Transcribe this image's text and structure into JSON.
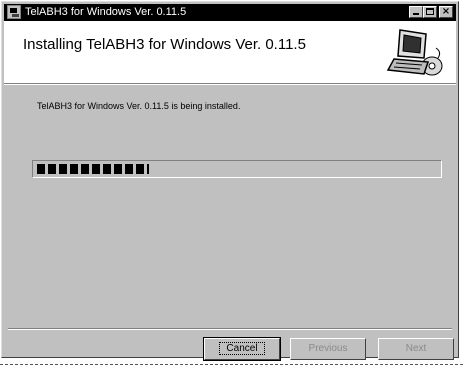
{
  "window": {
    "title": "TelABH3 for Windows Ver. 0.11.5"
  },
  "header": {
    "title": "Installing TelABH3 for Windows Ver. 0.11.5",
    "icon": "computer-install-icon"
  },
  "main": {
    "status_text": "TelABH3 for Windows Ver. 0.11.5 is being installed.",
    "progress_fraction": 0.28
  },
  "buttons": {
    "cancel": "Cancel",
    "previous": "Previous",
    "next": "Next"
  },
  "colors": {
    "face": "#c0c0c0",
    "titlebar": "#000000",
    "disabled_text": "#8a8a8a"
  }
}
